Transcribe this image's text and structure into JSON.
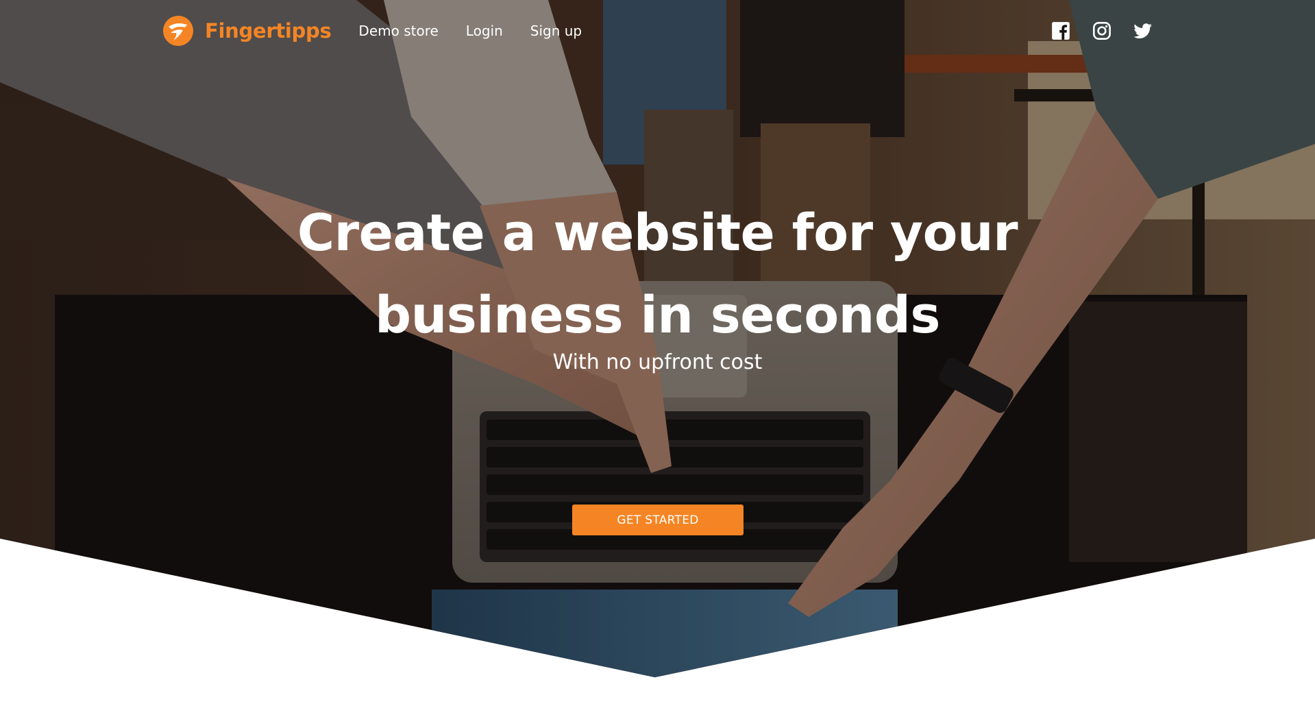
{
  "brand": {
    "name": "Fingertipps",
    "logo_icon": "fingertipps-logo-icon",
    "color": "#f58524"
  },
  "nav": {
    "items": [
      {
        "label": "Demo store"
      },
      {
        "label": "Login"
      },
      {
        "label": "Sign up"
      }
    ]
  },
  "social": {
    "icons": [
      "facebook-icon",
      "instagram-icon",
      "twitter-icon"
    ]
  },
  "hero": {
    "headline_line1": "Create a website for your",
    "headline_line2": "business in seconds",
    "subheadline": "With no upfront cost",
    "cta_label": "GET STARTED",
    "cta_color": "#f58524"
  }
}
